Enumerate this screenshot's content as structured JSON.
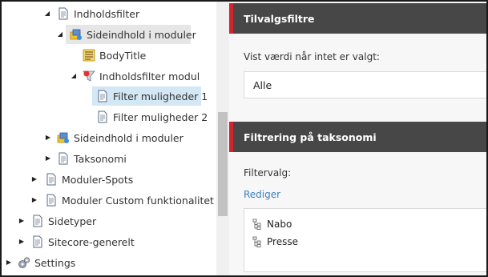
{
  "tree": {
    "items": [
      {
        "label": "Indholdsfilter",
        "icon": "document-icon",
        "expanded": true
      },
      {
        "label": "Sideindhold i moduler",
        "icon": "module-folder-icon",
        "expanded": true
      },
      {
        "label": "BodyTitle",
        "icon": "template-field-icon"
      },
      {
        "label": "Indholdsfilter modul",
        "icon": "filter-module-icon",
        "expanded": true
      },
      {
        "label": "Filter muligheder 1",
        "icon": "document-icon",
        "selected": true
      },
      {
        "label": "Filter muligheder 2",
        "icon": "document-icon"
      },
      {
        "label": "Sideindhold i moduler",
        "icon": "module-folder-icon",
        "expanded": false
      },
      {
        "label": "Taksonomi",
        "icon": "document-icon",
        "expanded": false
      },
      {
        "label": "Moduler-Spots",
        "icon": "document-icon",
        "expanded": false
      },
      {
        "label": "Moduler Custom funktionalitet",
        "icon": "document-icon",
        "expanded": false
      },
      {
        "label": "Sidetyper",
        "icon": "document-icon",
        "expanded": false
      },
      {
        "label": "Sitecore-generelt",
        "icon": "document-icon",
        "expanded": false
      },
      {
        "label": "Settings",
        "icon": "settings-icon",
        "expanded": false
      }
    ]
  },
  "sections": {
    "optional_filters": {
      "title": "Tilvalgsfiltre",
      "field_label": "Vist værdi når intet er valgt:",
      "field_value": "Alle"
    },
    "taxonomy_filtering": {
      "title": "Filtrering på taksonomi",
      "field_label": "Filtervalg:",
      "edit_link": "Rediger",
      "items": [
        "Nabo",
        "Presse"
      ]
    }
  },
  "colors": {
    "header_bg": "#474747",
    "accent": "#d0252c",
    "link": "#3b7fc4",
    "selected_bg": "#d4e7f5",
    "active_bg": "#e6e6e6"
  }
}
